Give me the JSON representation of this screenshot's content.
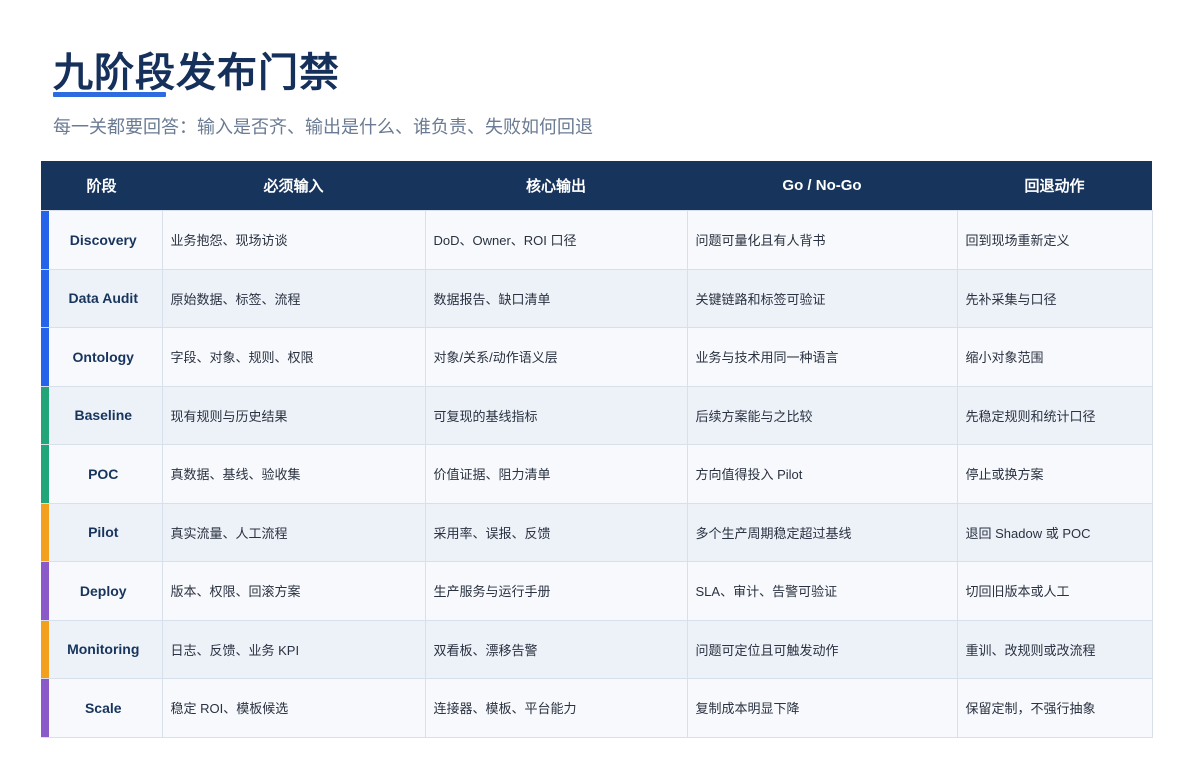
{
  "title": "九阶段发布门禁",
  "subtitle": "每一关都要回答：输入是否齐、输出是什么、谁负责、失败如何回退",
  "colors": {
    "header_bg": "#17345d",
    "accent_blue": "#2f6be0",
    "stage_blue": "#2563eb",
    "stage_green": "#22a579",
    "stage_orange": "#f2a01e",
    "stage_purple": "#8a5ac8"
  },
  "table": {
    "headers": [
      "阶段",
      "必须输入",
      "核心输出",
      "Go / No-Go",
      "回退动作"
    ],
    "rows": [
      {
        "stage": "Discovery",
        "color": "#2563eb",
        "input": "业务抱怨、现场访谈",
        "output": "DoD、Owner、ROI 口径",
        "gate": "问题可量化且有人背书",
        "rollback": "回到现场重新定义"
      },
      {
        "stage": "Data Audit",
        "color": "#2563eb",
        "input": "原始数据、标签、流程",
        "output": "数据报告、缺口清单",
        "gate": "关键链路和标签可验证",
        "rollback": "先补采集与口径"
      },
      {
        "stage": "Ontology",
        "color": "#2563eb",
        "input": "字段、对象、规则、权限",
        "output": "对象/关系/动作语义层",
        "gate": "业务与技术用同一种语言",
        "rollback": "缩小对象范围"
      },
      {
        "stage": "Baseline",
        "color": "#22a579",
        "input": "现有规则与历史结果",
        "output": "可复现的基线指标",
        "gate": "后续方案能与之比较",
        "rollback": "先稳定规则和统计口径"
      },
      {
        "stage": "POC",
        "color": "#22a579",
        "input": "真数据、基线、验收集",
        "output": "价值证据、阻力清单",
        "gate": "方向值得投入 Pilot",
        "rollback": "停止或换方案"
      },
      {
        "stage": "Pilot",
        "color": "#f2a01e",
        "input": "真实流量、人工流程",
        "output": "采用率、误报、反馈",
        "gate": "多个生产周期稳定超过基线",
        "rollback": "退回 Shadow 或 POC"
      },
      {
        "stage": "Deploy",
        "color": "#8a5ac8",
        "input": "版本、权限、回滚方案",
        "output": "生产服务与运行手册",
        "gate": "SLA、审计、告警可验证",
        "rollback": "切回旧版本或人工"
      },
      {
        "stage": "Monitoring",
        "color": "#f2a01e",
        "input": "日志、反馈、业务 KPI",
        "output": "双看板、漂移告警",
        "gate": "问题可定位且可触发动作",
        "rollback": "重训、改规则或改流程"
      },
      {
        "stage": "Scale",
        "color": "#8a5ac8",
        "input": "稳定 ROI、模板候选",
        "output": "连接器、模板、平台能力",
        "gate": "复制成本明显下降",
        "rollback": "保留定制，不强行抽象"
      }
    ]
  }
}
